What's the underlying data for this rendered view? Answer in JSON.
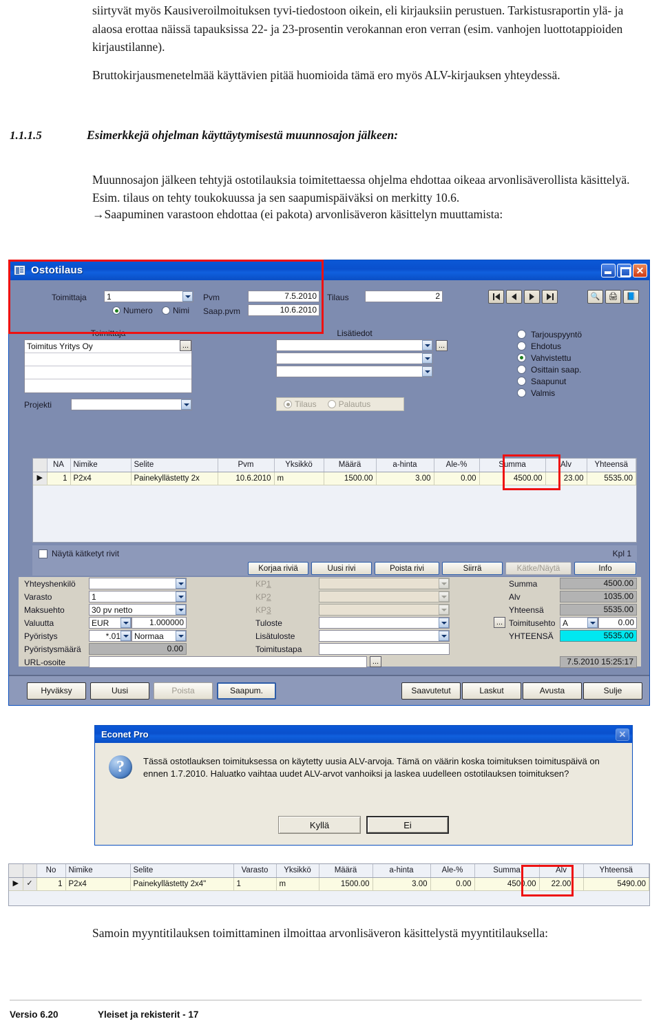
{
  "document": {
    "intro_paragraphs": [
      "siirtyvät myös Kausiveroilmoituksen tyvi-tiedostoon oikein, eli kirjauksiin perustuen. Tarkistusraportin ylä- ja alaosa erottaa näissä tapauksissa 22- ja 23-prosentin verokannan eron verran (esim. vanhojen luottotappioiden kirjaustilanne).",
      "Bruttokirjausmenetelmää käyttävien pitää huomioida tämä ero myös ALV-kirjauksen yhteydessä."
    ],
    "heading": {
      "number": "1.1.1.5",
      "text": "Esimerkkejä ohjelman käyttäytymisestä muunnosajon jälkeen:"
    },
    "example_lines": [
      "Muunnosajon jälkeen tehtyjä ostotilauksia toimitettaessa ohjelma ehdottaa oikeaa arvonlisäverollista käsittelyä.",
      "Esim. tilaus on tehty toukokuussa ja sen saapumispäiväksi on merkitty 10.6.",
      "→Saapuminen varastoon ehdottaa (ei pakota) arvonlisäveron käsittelyn muuttamista:"
    ],
    "closing_paragraph": "Samoin myyntitilauksen toimittaminen ilmoittaa arvonlisäveron käsittelystä myyntitilauksella:",
    "footer": {
      "version": "Versio 6.20",
      "section": "Yleiset ja rekisterit - 17"
    }
  },
  "app_window": {
    "title": "Ostotilaus",
    "window_buttons": {
      "minimize": "_",
      "maximize": "□",
      "close": "✕"
    },
    "header": {
      "supplier_label": "Toimittaja",
      "supplier_value": "1",
      "radio_numero": "Numero",
      "radio_nimi": "Nimi",
      "pvm_label": "Pvm",
      "pvm_value": "7.5.2010",
      "saap_pvm_label": "Saap.pvm",
      "saap_pvm_value": "10.6.2010",
      "tilaus_label": "Tilaus",
      "tilaus_value": "2"
    },
    "nav_buttons": [
      "first-record",
      "prev-record",
      "next-record",
      "last-record"
    ],
    "tool_buttons": [
      "preview-icon",
      "print-icon",
      "book-icon"
    ],
    "supplier_section": {
      "title": "Toimittaja",
      "lines": [
        "Toimitus Yritys Oy",
        "",
        "",
        ""
      ],
      "projekti_label": "Projekti",
      "projekti_value": ""
    },
    "extra_section": {
      "title": "Lisätiedot",
      "lines": [
        "",
        "",
        ""
      ],
      "tilaus_radio": "Tilaus",
      "palautus_radio": "Palautus"
    },
    "status_options": [
      {
        "label": "Tarjouspyyntö",
        "selected": false
      },
      {
        "label": "Ehdotus",
        "selected": false
      },
      {
        "label": "Vahvistettu",
        "selected": true
      },
      {
        "label": "Osittain saap.",
        "selected": false
      },
      {
        "label": "Saapunut",
        "selected": false
      },
      {
        "label": "Valmis",
        "selected": false
      }
    ],
    "grid": {
      "headers": [
        "",
        "NA",
        "Nimike",
        "Selite",
        "Pvm",
        "Yksikkö",
        "Määrä",
        "a-hinta",
        "Ale-%",
        "Summa",
        "Alv",
        "Yhteensä"
      ],
      "rows": [
        {
          "marker": "▶",
          "no": "1",
          "nimike": "P2x4",
          "selite": "Painekyllästetty 2x",
          "pvm": "10.6.2010",
          "yksikko": "m",
          "maara": "1500.00",
          "ahinta": "3.00",
          "ale": "0.00",
          "summa": "4500.00",
          "alv": "23.00",
          "yhteensa": "5535.00"
        }
      ]
    },
    "row_toolbar": {
      "show_hidden_label": "Näytä kätketyt rivit",
      "count_label": "Kpl  1",
      "buttons": [
        {
          "label": "Korjaa riviä",
          "disabled": false
        },
        {
          "label": "Uusi rivi",
          "disabled": false
        },
        {
          "label": "Poista rivi",
          "disabled": false
        },
        {
          "label": "Siirrä",
          "disabled": false
        },
        {
          "label": "Kätke/Näytä",
          "disabled": true
        },
        {
          "label": "Info",
          "disabled": false
        }
      ]
    },
    "left_fields": [
      {
        "label": "Yhteyshenkilö",
        "value": ""
      },
      {
        "label": "Varasto",
        "value": "1"
      },
      {
        "label": "Maksuehto",
        "value": "30 pv netto"
      }
    ],
    "currency": {
      "label": "Valuutta",
      "value": "EUR",
      "rate": "1.000000"
    },
    "rounding": {
      "label": "Pyöristys",
      "value": "*.01",
      "mode": "Normaa"
    },
    "rounding_amount": {
      "label": "Pyöristysmäärä",
      "value": "0.00"
    },
    "url_field": {
      "label": "URL-osoite",
      "value": ""
    },
    "mid_fields": [
      {
        "label": "KP1",
        "value": "",
        "disabled": true
      },
      {
        "label": "KP2",
        "value": "",
        "disabled": true
      },
      {
        "label": "KP3",
        "value": "",
        "disabled": true
      },
      {
        "label": "Tuloste",
        "value": "",
        "disabled": false
      },
      {
        "label": "Lisätuloste",
        "value": "",
        "disabled": false
      },
      {
        "label": "Toimitustapa",
        "value": "",
        "disabled": false
      }
    ],
    "totals": [
      {
        "label": "Summa",
        "value": "4500.00"
      },
      {
        "label": "Alv",
        "value": "1035.00"
      },
      {
        "label": "Yhteensä",
        "value": "5535.00"
      }
    ],
    "delivery_term": {
      "label": "Toimitusehto",
      "value": "A",
      "amount": "0.00"
    },
    "grand_total": {
      "label": "YHTEENSÄ",
      "value": "5535.00"
    },
    "timestamp": "7.5.2010 15:25:17",
    "bottom_buttons": [
      {
        "label": "Hyväksy",
        "disabled": false,
        "focus": false
      },
      {
        "label": "Uusi",
        "disabled": false,
        "focus": false
      },
      {
        "label": "Poista",
        "disabled": true,
        "focus": false
      },
      {
        "label": "Saapum.",
        "disabled": false,
        "focus": true
      },
      {
        "label": "Saavutetut",
        "disabled": false,
        "focus": false
      },
      {
        "label": "Laskut",
        "disabled": false,
        "focus": false
      },
      {
        "label": "Avusta",
        "disabled": false,
        "focus": false
      },
      {
        "label": "Sulje",
        "disabled": false,
        "focus": false
      }
    ]
  },
  "dialog": {
    "title": "Econet Pro",
    "icon": "question-icon",
    "close_label": "✕",
    "message": "Tässä ostotlauksen toimituksessa on käytetty uusia ALV-arvoja. Tämä on väärin koska toimituksen toimituspäivä on ennen 1.7.2010. Haluatko vaihtaa uudet ALV-arvot vanhoiksi ja laskea uudelleen ostotilauksen toimituksen?",
    "buttons": [
      {
        "label": "Kyllä",
        "focus": false
      },
      {
        "label": "Ei",
        "focus": true
      }
    ]
  },
  "lower_grid": {
    "headers": [
      "",
      "",
      "No",
      "Nimike",
      "Selite",
      "Varasto",
      "Yksikkö",
      "Määrä",
      "a-hinta",
      "Ale-%",
      "Summa",
      "Alv",
      "Yhteensä"
    ],
    "rows": [
      {
        "marker": "▶",
        "check": "✓",
        "no": "1",
        "nimike": "P2x4",
        "selite": "Painekyllästetty 2x4\"",
        "varasto": "1",
        "yksikko": "m",
        "maara": "1500.00",
        "ahinta": "3.00",
        "ale": "0.00",
        "summa": "4500.00",
        "alv": "22.00",
        "yhteensa": "5490.00"
      }
    ]
  },
  "colors": {
    "highlight_red": "#ee1111",
    "title_blue": "#0b58d6",
    "panel_blue_grey": "#7e8cb0",
    "grid_row_yellow": "#fbfbe3",
    "total_cyan": "#00e8f0"
  }
}
